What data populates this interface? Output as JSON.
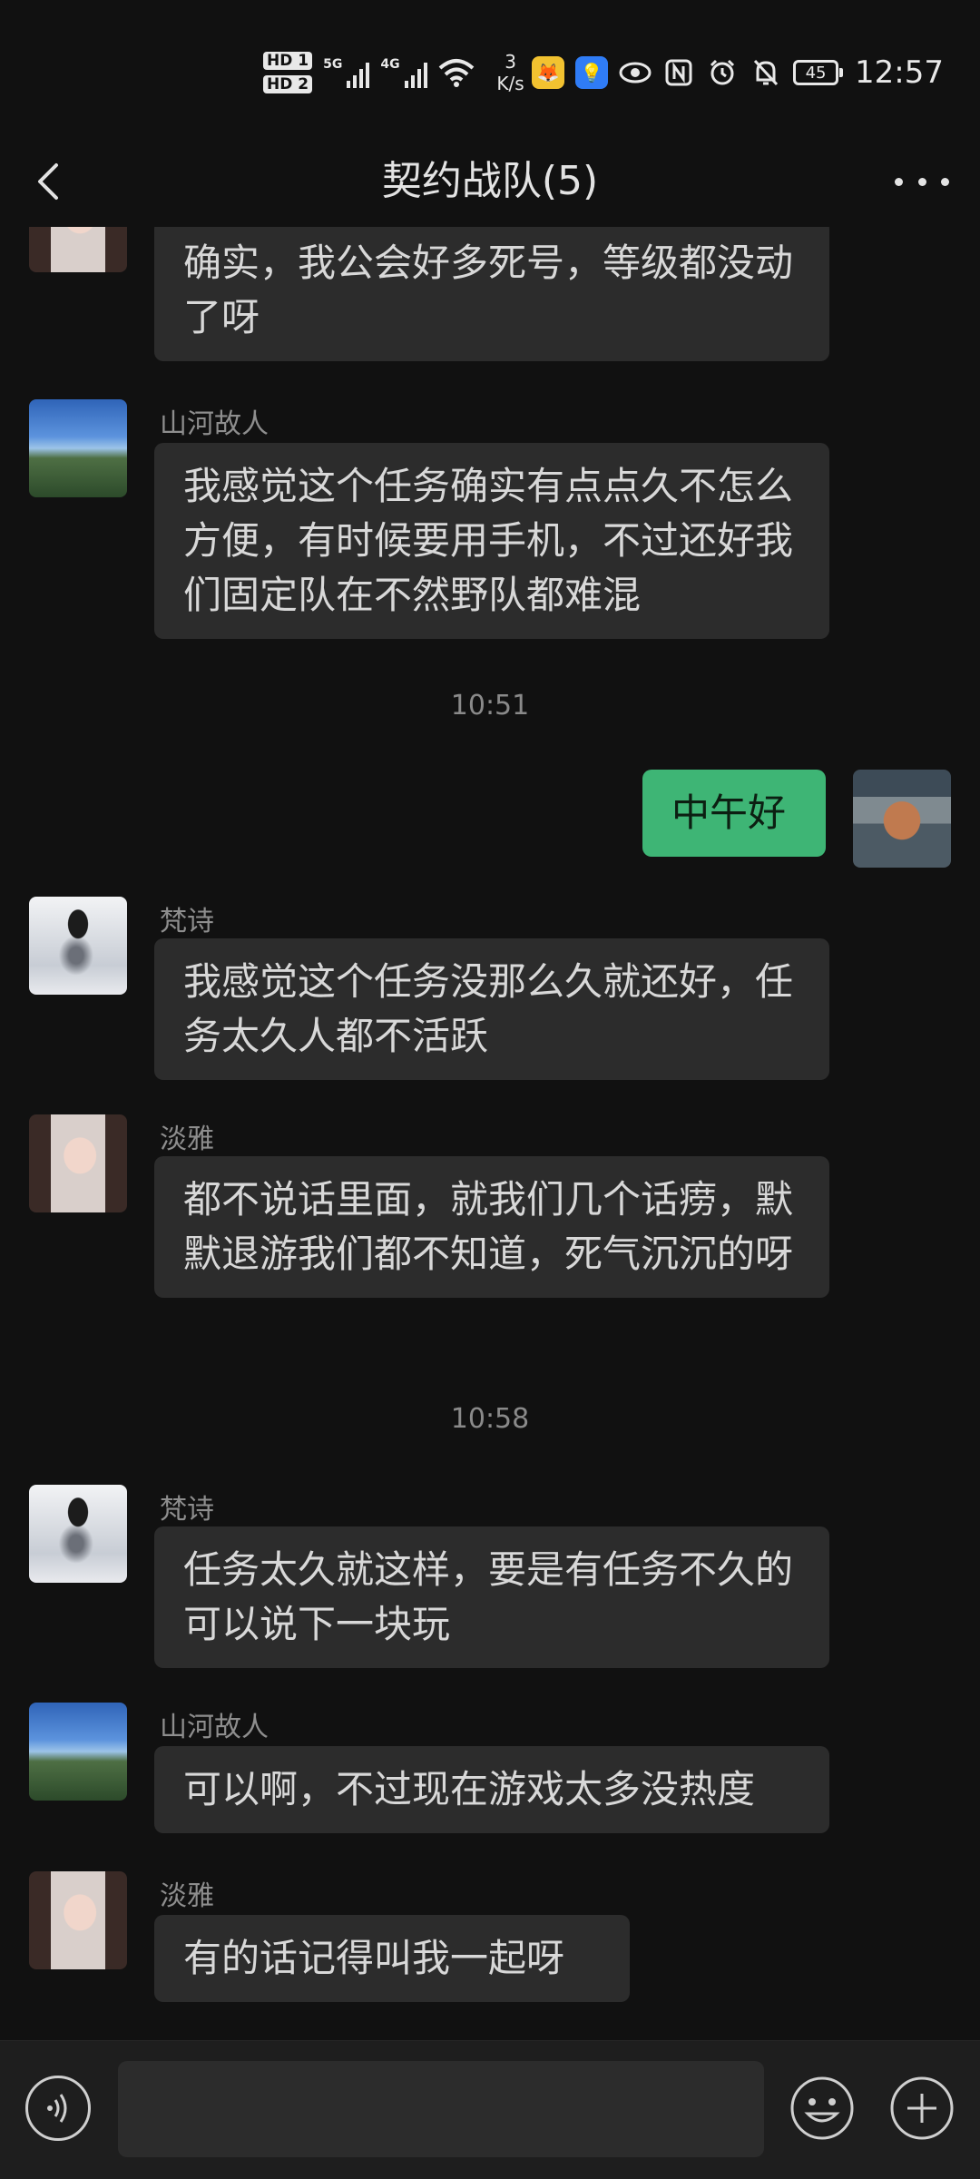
{
  "status_bar": {
    "hd1": "HD 1",
    "hd2": "HD 2",
    "net1": "5G",
    "net2": "4G",
    "speed_value": "3",
    "speed_unit": "K/s",
    "battery": "45",
    "time": "12:57"
  },
  "header": {
    "title": "契约战队(5)"
  },
  "messages": [
    {
      "type": "incoming",
      "sender": "",
      "avatar": "girl",
      "text": "确实，我公会好多死号，等级都没动了呀"
    },
    {
      "type": "incoming",
      "sender": "山河故人",
      "avatar": "mountain",
      "text": "我感觉这个任务确实有点点久不怎么方便，有时候要用手机，不过还好我们固定队在不然野队都难混"
    },
    {
      "type": "time",
      "text": "10:51"
    },
    {
      "type": "outgoing",
      "avatar": "man",
      "text": "中午好"
    },
    {
      "type": "incoming",
      "sender": "梵诗",
      "avatar": "umbrella",
      "text": "我感觉这个任务没那么久就还好，任务太久人都不活跃"
    },
    {
      "type": "incoming",
      "sender": "淡雅",
      "avatar": "girl",
      "text": "都不说话里面，就我们几个话痨，默默退游我们都不知道，死气沉沉的呀"
    },
    {
      "type": "time",
      "text": "10:58"
    },
    {
      "type": "incoming",
      "sender": "梵诗",
      "avatar": "umbrella",
      "text": "任务太久就这样，要是有任务不久的可以说下一块玩"
    },
    {
      "type": "incoming",
      "sender": "山河故人",
      "avatar": "mountain",
      "text": "可以啊，不过现在游戏太多没热度"
    },
    {
      "type": "incoming",
      "sender": "淡雅",
      "avatar": "girl",
      "text": "有的话记得叫我一起呀"
    }
  ],
  "input_bar": {
    "value": ""
  }
}
